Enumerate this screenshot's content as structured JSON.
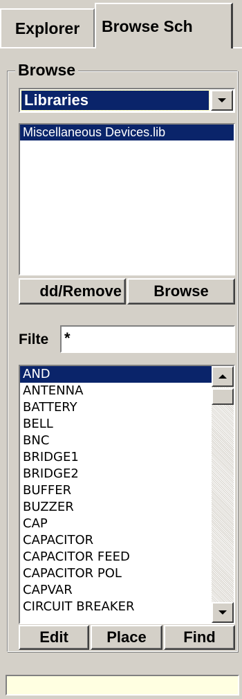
{
  "tabs": [
    {
      "label": "Explorer",
      "active": false
    },
    {
      "label": "Browse Sch",
      "active": true
    }
  ],
  "browse": {
    "group_label": "Browse",
    "combo_value": "Libraries",
    "libraries": [
      "Miscellaneous Devices.lib"
    ],
    "add_remove_label": "dd/Remove",
    "browse_button_label": "Browse",
    "filter_label": "Filte",
    "filter_value": "*",
    "components": [
      "AND",
      "ANTENNA",
      "BATTERY",
      "BELL",
      "BNC",
      "BRIDGE1",
      "BRIDGE2",
      "BUFFER",
      "BUZZER",
      "CAP",
      "CAPACITOR",
      "CAPACITOR FEED",
      "CAPACITOR POL",
      "CAPVAR",
      "CIRCUIT BREAKER"
    ],
    "edit_label": "Edit",
    "place_label": "Place",
    "find_label": "Find"
  },
  "status": {
    "text": ""
  },
  "icons": {
    "dropdown": "chevron-down-icon",
    "scroll_up": "arrow-up-icon",
    "scroll_down": "arrow-down-icon"
  },
  "colors": {
    "face": "#d4d0c8",
    "selection": "#0a246a",
    "status_bg": "#ffffe1"
  }
}
